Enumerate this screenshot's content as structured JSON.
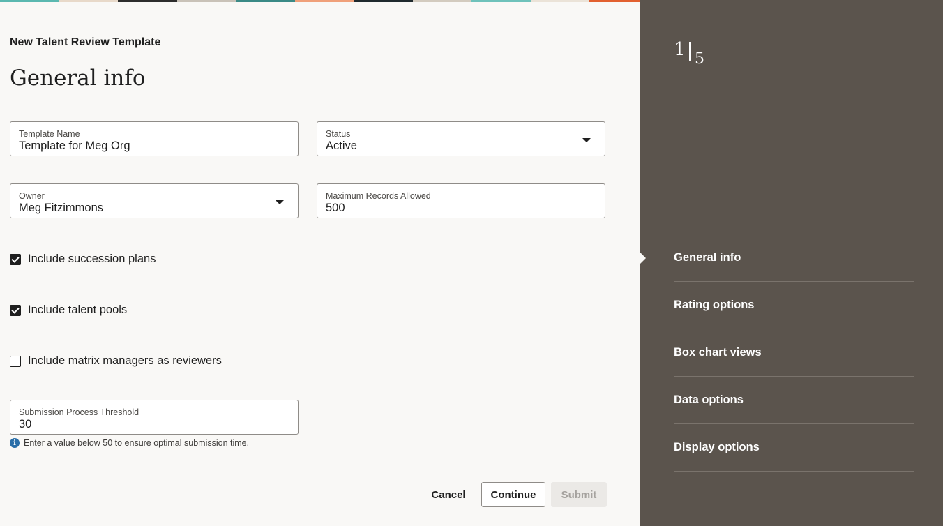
{
  "header": {
    "subtitle": "New Talent Review Template",
    "title": "General info"
  },
  "form": {
    "template_name": {
      "label": "Template Name",
      "value": "Template for Meg Org"
    },
    "status": {
      "label": "Status",
      "value": "Active"
    },
    "owner": {
      "label": "Owner",
      "value": "Meg Fitzimmons"
    },
    "max_records": {
      "label": "Maximum Records Allowed",
      "value": "500"
    },
    "checkboxes": [
      {
        "label": "Include succession plans",
        "checked": true
      },
      {
        "label": "Include talent pools",
        "checked": true
      },
      {
        "label": "Include matrix managers as reviewers",
        "checked": false
      }
    ],
    "threshold": {
      "label": "Submission Process Threshold",
      "value": "30"
    },
    "hint": "Enter a value below 50 to ensure optimal submission time."
  },
  "buttons": {
    "cancel": "Cancel",
    "continue": "Continue",
    "submit": "Submit"
  },
  "stepper": {
    "current": "1",
    "total": "5",
    "steps": [
      {
        "label": "General info",
        "active": true
      },
      {
        "label": "Rating options"
      },
      {
        "label": "Box chart views"
      },
      {
        "label": "Data options"
      },
      {
        "label": "Display options"
      }
    ]
  },
  "colors": {
    "sidebar_bg": "#5b544d",
    "page_bg": "#f9f8f6",
    "info_blue": "#2a6ea8",
    "strip": [
      "#5bb8b0",
      "#e8d9c9",
      "#2d2d2d",
      "#c9c2b8",
      "#3b8a86",
      "#f0a07a",
      "#1f2a2e",
      "#d3cbbf",
      "#6fc2bb",
      "#ebe3d8",
      "#e2602f",
      "#f2b98f",
      "#444",
      "#9fd1cc",
      "#cfc7bb",
      "#2f3a3a"
    ]
  }
}
